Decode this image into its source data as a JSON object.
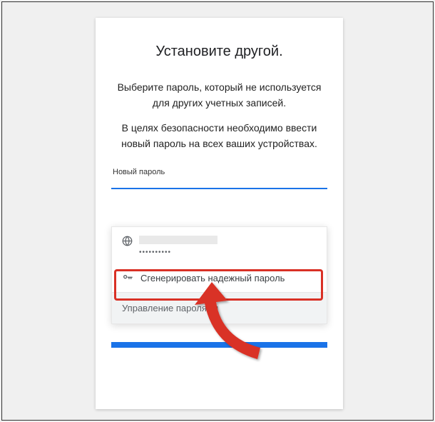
{
  "title": "Установите другой.",
  "description1": "Выберите пароль, который не используется для других учетных записей.",
  "description2": "В целях безопасности необходимо ввести новый пароль на всех ваших устройствах.",
  "field_label": "Новый пароль",
  "popup": {
    "saved_dots": "••••••••••",
    "generate_label": "Сгенерировать надежный пароль",
    "manage_label": "Управление паролями"
  }
}
